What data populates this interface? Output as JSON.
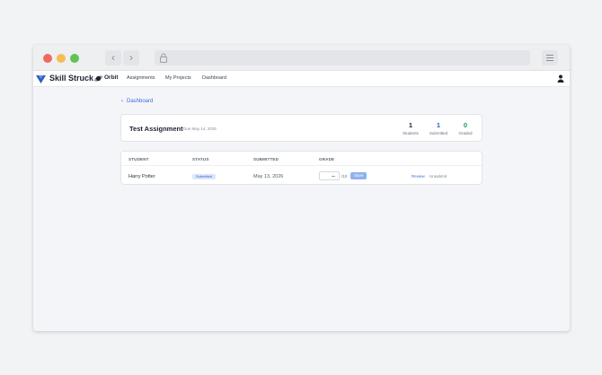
{
  "browser": {
    "icons": [
      "chevron-left-icon",
      "chevron-right-icon",
      "lock-icon",
      "hamburger-menu-icon"
    ]
  },
  "nav": {
    "brand": "Skill Struck",
    "product": "Orbit",
    "links": [
      "Assignments",
      "My Projects",
      "Dashboard"
    ]
  },
  "breadcrumb": {
    "label": "Dashboard"
  },
  "assignment": {
    "title": "Test Assignment",
    "due": "Due May 14, 2026",
    "stats": [
      {
        "value": "1",
        "label": "Students",
        "color": "#1d2130"
      },
      {
        "value": "1",
        "label": "Submitted",
        "color": "#2f5fc4"
      },
      {
        "value": "0",
        "label": "Graded",
        "color": "#1e9a5a"
      }
    ]
  },
  "table": {
    "headers": [
      "STUDENT",
      "STATUS",
      "SUBMITTED",
      "GRADE"
    ],
    "rows": [
      {
        "student": "Harry Potter",
        "status": "Submitted",
        "submitted": "May 13, 2026",
        "grade_value": "",
        "grade_out_of": "/10",
        "save_label": "Save",
        "review_label": "Review",
        "unsubmit_label": "Unsubmit"
      }
    ]
  },
  "colors": {
    "accent": "#3a6fd8",
    "status_badge_bg": "#dbe6fb",
    "save_button": "#8fb1ee"
  }
}
